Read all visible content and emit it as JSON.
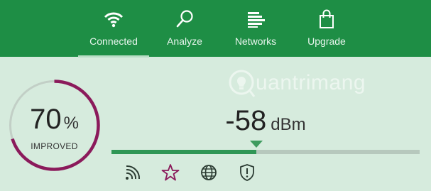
{
  "tabs": [
    {
      "label": "Connected",
      "icon": "wifi-icon",
      "active": true
    },
    {
      "label": "Analyze",
      "icon": "magnifier-icon",
      "active": false
    },
    {
      "label": "Networks",
      "icon": "networks-list-icon",
      "active": false
    },
    {
      "label": "Upgrade",
      "icon": "shopping-bag-icon",
      "active": false
    }
  ],
  "watermark": {
    "text": "uantrimang",
    "icon": "lightbulb-icon"
  },
  "improvement": {
    "value": "70",
    "unit": "%",
    "label": "IMPROVED",
    "fraction": 0.7
  },
  "signal": {
    "value": "-58",
    "unit": "dBm",
    "level_fraction": 0.47
  },
  "bottom_icons": [
    "signal-strength-icon",
    "star-icon",
    "globe-icon",
    "shield-alert-icon"
  ],
  "colors": {
    "header": "#1e8e45",
    "background": "#d6ebdd",
    "ring_progress": "#8b1a5b",
    "ring_track": "#c2cfc6",
    "meter_fill": "#2f9655",
    "star": "#8b1a5b"
  }
}
